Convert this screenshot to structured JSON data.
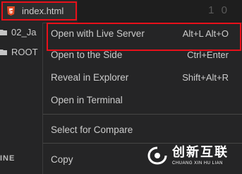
{
  "editor": {
    "line_number": "1 0"
  },
  "tab": {
    "file_name": "index.html",
    "icon": "html5-icon",
    "icon_color": "#e44d26"
  },
  "sidebar": {
    "items": [
      {
        "label": "02_Ja",
        "icon": "folder-icon"
      },
      {
        "label": "ROOT",
        "icon": "folder-icon"
      }
    ],
    "bottom_label": "INE"
  },
  "context_menu": {
    "items": [
      {
        "label": "Open with Live Server",
        "shortcut": "Alt+L Alt+O"
      },
      {
        "label": "Open to the Side",
        "shortcut": "Ctrl+Enter"
      },
      {
        "label": "Reveal in Explorer",
        "shortcut": "Shift+Alt+R"
      },
      {
        "label": "Open in Terminal",
        "shortcut": ""
      },
      {
        "label": "Select for Compare",
        "shortcut": ""
      },
      {
        "label": "Copy",
        "shortcut": ""
      }
    ]
  },
  "highlight_color": "#e8101a",
  "watermark": {
    "chinese": "创新互联",
    "english": "CHUANG XIN HU LIAN"
  }
}
